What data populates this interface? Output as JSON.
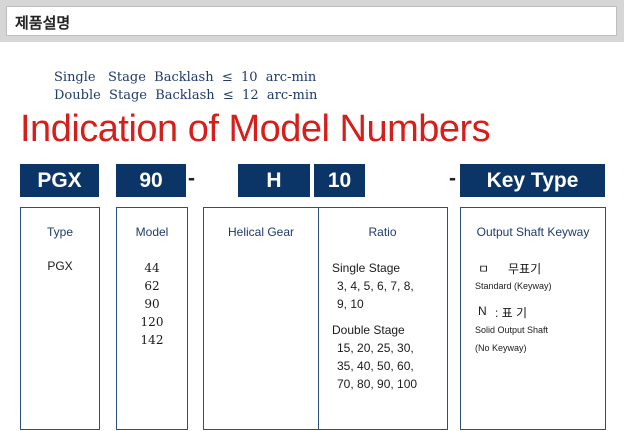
{
  "header": {
    "title": "제품설명"
  },
  "backlash": {
    "single": "Single   Stage  Backlash  ≤  10  arc-min",
    "double": "Double  Stage  Backlash  ≤  12  arc-min"
  },
  "main_title": "Indication of Model Numbers",
  "code": {
    "pgx": "PGX",
    "model": "90",
    "dash": "-",
    "gear": "H",
    "ratio": "10",
    "key": "Key Type"
  },
  "type_panel": {
    "heading": "Type",
    "value": "PGX"
  },
  "model_panel": {
    "heading": "Model",
    "values": [
      "44",
      "62",
      "90",
      "120",
      "142"
    ]
  },
  "gear_panel": {
    "heading": "Helical Gear"
  },
  "ratio_panel": {
    "heading": "Ratio",
    "single_label": "Single Stage",
    "single_values": [
      "3, 4, 5, 6, 7, 8,",
      "9, 10"
    ],
    "double_label": "Double Stage",
    "double_values": [
      "15, 20, 25, 30,",
      "35, 40, 50, 60,",
      "70, 80, 90, 100"
    ]
  },
  "key_panel": {
    "heading": "Output Shaft Keyway",
    "std_mark": "ㅁ",
    "std_label": "무표기",
    "std_desc": "Standard (Keyway)",
    "n_mark": "N",
    "n_label": ": 표   기",
    "n_desc1": "Solid Output Shaft",
    "n_desc2": "(No Keyway)"
  }
}
